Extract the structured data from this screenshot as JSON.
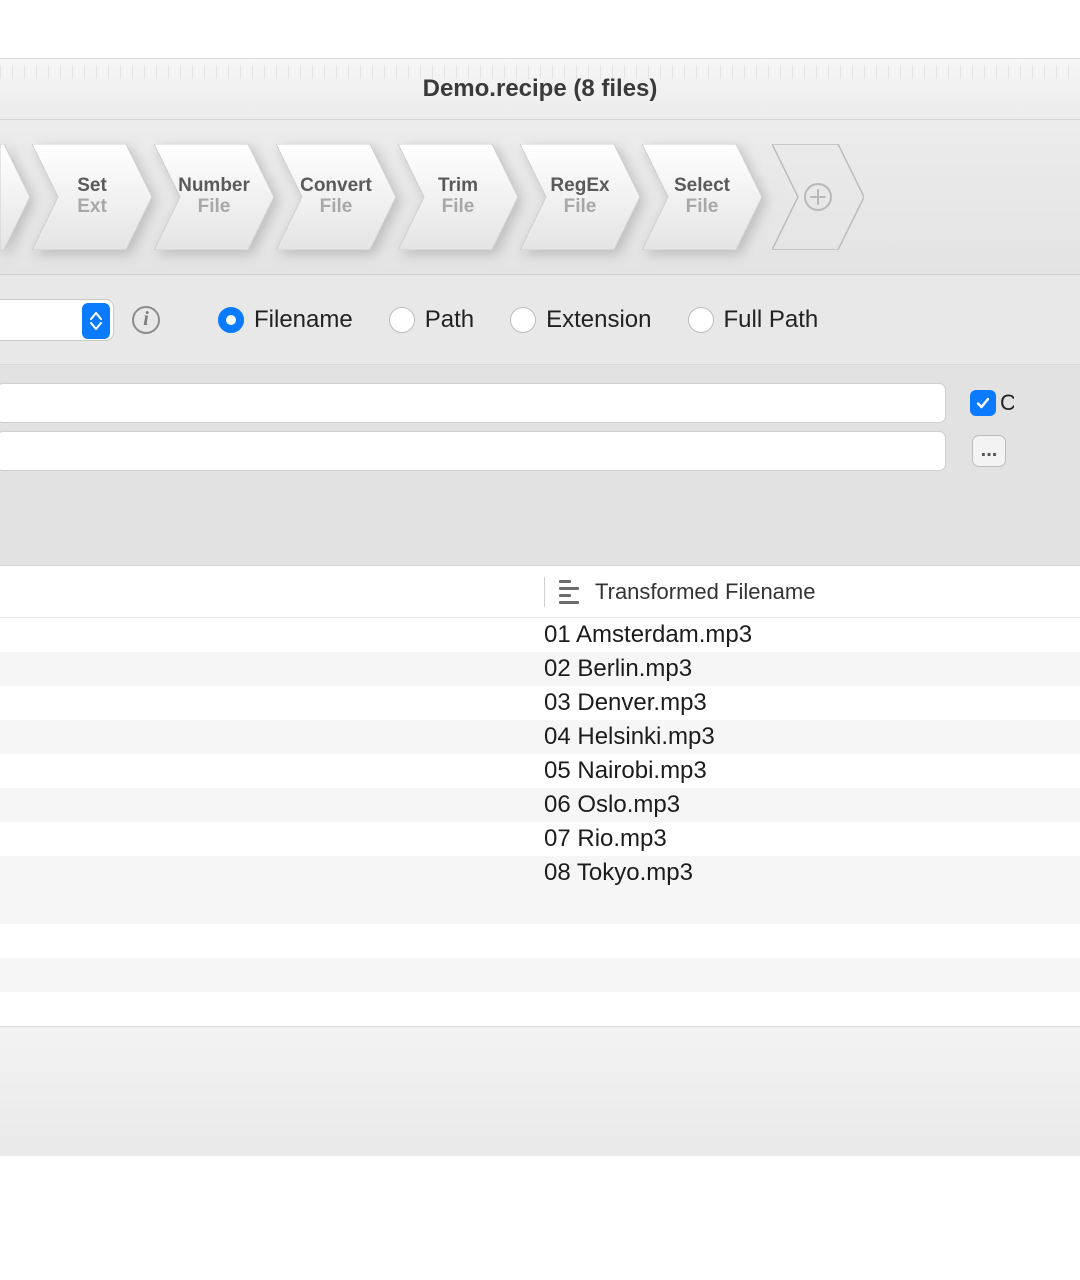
{
  "title": "Demo.recipe (8 files)",
  "steps": [
    {
      "label": "Set",
      "sub": "Ext"
    },
    {
      "label": "Number",
      "sub": "File"
    },
    {
      "label": "Convert",
      "sub": "File"
    },
    {
      "label": "Trim",
      "sub": "File"
    },
    {
      "label": "RegEx",
      "sub": "File"
    },
    {
      "label": "Select",
      "sub": "File"
    }
  ],
  "options": {
    "radios": [
      "Filename",
      "Path",
      "Extension",
      "Full Path"
    ],
    "selected": "Filename",
    "checkbox_label": "C",
    "checkbox_checked": true,
    "more_button": "..."
  },
  "table": {
    "header": "Transformed Filename",
    "rows": [
      "01 Amsterdam.mp3",
      "02 Berlin.mp3",
      "03 Denver.mp3",
      "04 Helsinki.mp3",
      "05 Nairobi.mp3",
      "06 Oslo.mp3",
      "07 Rio.mp3",
      "08 Tokyo.mp3"
    ]
  }
}
